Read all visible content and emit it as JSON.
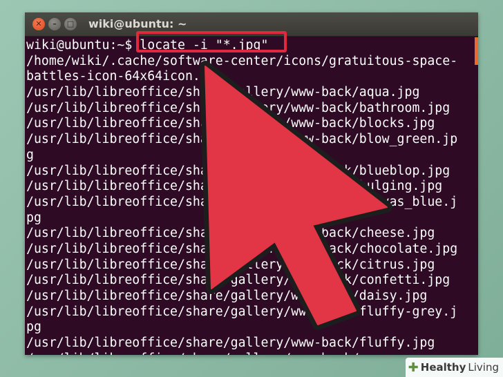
{
  "window": {
    "title": "wiki@ubuntu: ~",
    "close_glyph": "✕",
    "minimize_glyph": "–",
    "maximize_glyph": "□"
  },
  "terminal": {
    "prompt": "wiki@ubuntu:~$ ",
    "command": "locate -i \"*.jpg\"",
    "output": [
      "/home/wiki/.cache/software-center/icons/gratuitous-space-",
      "battles-icon-64x64icon.",
      "/usr/lib/libreoffice/share/gallery/www-back/aqua.jpg",
      "/usr/lib/libreoffice/share/gallery/www-back/bathroom.jpg",
      "/usr/lib/libreoffice/share/gallery/www-back/blocks.jpg",
      "/usr/lib/libreoffice/share/gallery/www-back/blow_green.jp",
      "g",
      "/usr/lib/libreoffice/share/gallery/www-back/blueblop.jpg",
      "/usr/lib/libreoffice/share/gallery/www-back/bulging.jpg",
      "/usr/lib/libreoffice/share/gallery/www-back/canvas_blue.j",
      "pg",
      "/usr/lib/libreoffice/share/gallery/www-back/cheese.jpg",
      "/usr/lib/libreoffice/share/gallery/www-back/chocolate.jpg",
      "/usr/lib/libreoffice/share/gallery/www-back/citrus.jpg",
      "/usr/lib/libreoffice/share/gallery/www-back/confetti.jpg",
      "/usr/lib/libreoffice/share/gallery/www-back/daisy.jpg",
      "/usr/lib/libreoffice/share/gallery/www-back/fluffy-grey.j",
      "pg",
      "/usr/lib/libreoffice/share/gallery/www-back/fluffy.jpg",
      "/usr/lib/libreoffice/share/gallery/www-back/"
    ]
  },
  "overlay": {
    "arrow_color": "#e23545",
    "highlight_color": "#e0293f"
  },
  "watermark": {
    "brand": "Healthy",
    "suffix": "Living"
  },
  "colors": {
    "terminal_bg": "#2f0a25",
    "terminal_text": "#ffffff",
    "titlebar": "#3b3a35",
    "close_button": "#de4a1e"
  }
}
